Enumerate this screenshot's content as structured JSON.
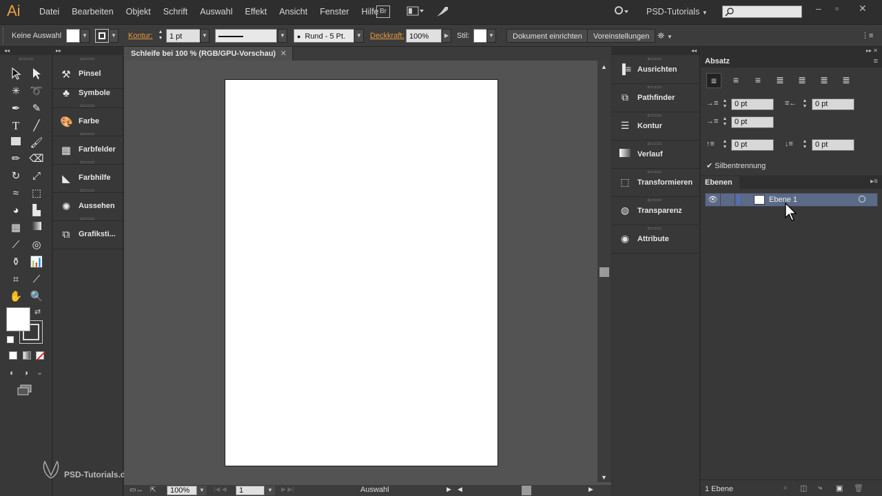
{
  "app": {
    "logo": "Ai"
  },
  "menu": [
    "Datei",
    "Bearbeiten",
    "Objekt",
    "Schrift",
    "Auswahl",
    "Effekt",
    "Ansicht",
    "Fenster",
    "Hilfe"
  ],
  "menubar": {
    "bridge": "Br",
    "workspace": "PSD-Tutorials",
    "search_value": ""
  },
  "control": {
    "selection": "Keine Auswahl",
    "stroke_label": "Kontur:",
    "stroke_value": "1 pt",
    "stroke_style": "Gleichm.",
    "brush": "Rund - 5 Pt.",
    "opacity_label": "Deckkraft:",
    "opacity_value": "100%",
    "style_label": "Stil:",
    "doc_setup": "Dokument einrichten",
    "preferences": "Voreinstellungen"
  },
  "doc": {
    "tab_title": "Schleife bei 100 % (RGB/GPU-Vorschau)"
  },
  "statusbar": {
    "zoom": "100%",
    "page": "1",
    "tool": "Auswahl"
  },
  "left_panels": [
    {
      "label": "Pinsel",
      "icon": "brush-icon"
    },
    {
      "label": "Symbole",
      "icon": "symbols-icon"
    },
    {
      "label": "Farbe",
      "icon": "color-palette-icon"
    },
    {
      "label": "Farbfelder",
      "icon": "swatches-icon"
    },
    {
      "label": "Farbhilfe",
      "icon": "color-guide-icon"
    },
    {
      "label": "Aussehen",
      "icon": "appearance-icon"
    },
    {
      "label": "Grafiksti...",
      "icon": "graphic-styles-icon"
    }
  ],
  "right_panels": [
    {
      "label": "Ausrichten",
      "icon": "align-icon"
    },
    {
      "label": "Pathfinder",
      "icon": "pathfinder-icon"
    },
    {
      "label": "Kontur",
      "icon": "stroke-icon"
    },
    {
      "label": "Verlauf",
      "icon": "gradient-icon"
    },
    {
      "label": "Transformieren",
      "icon": "transform-icon"
    },
    {
      "label": "Transparenz",
      "icon": "transparency-icon"
    },
    {
      "label": "Attribute",
      "icon": "attributes-icon"
    }
  ],
  "absatz": {
    "title": "Absatz",
    "indent_left": "0 pt",
    "indent_right": "0 pt",
    "first_line": "0 pt",
    "space_before": "0 pt",
    "space_after": "0 pt",
    "hyphenation": "Silbentrennung"
  },
  "ebenen": {
    "title": "Ebenen",
    "layer_name": "Ebene 1",
    "footer": "1 Ebene"
  },
  "watermark": "PSD-Tutorials.de",
  "colors": {
    "accent": "#e89a3c",
    "layer_row": "#5b6b87",
    "layer_bar": "#4b6fd8"
  }
}
